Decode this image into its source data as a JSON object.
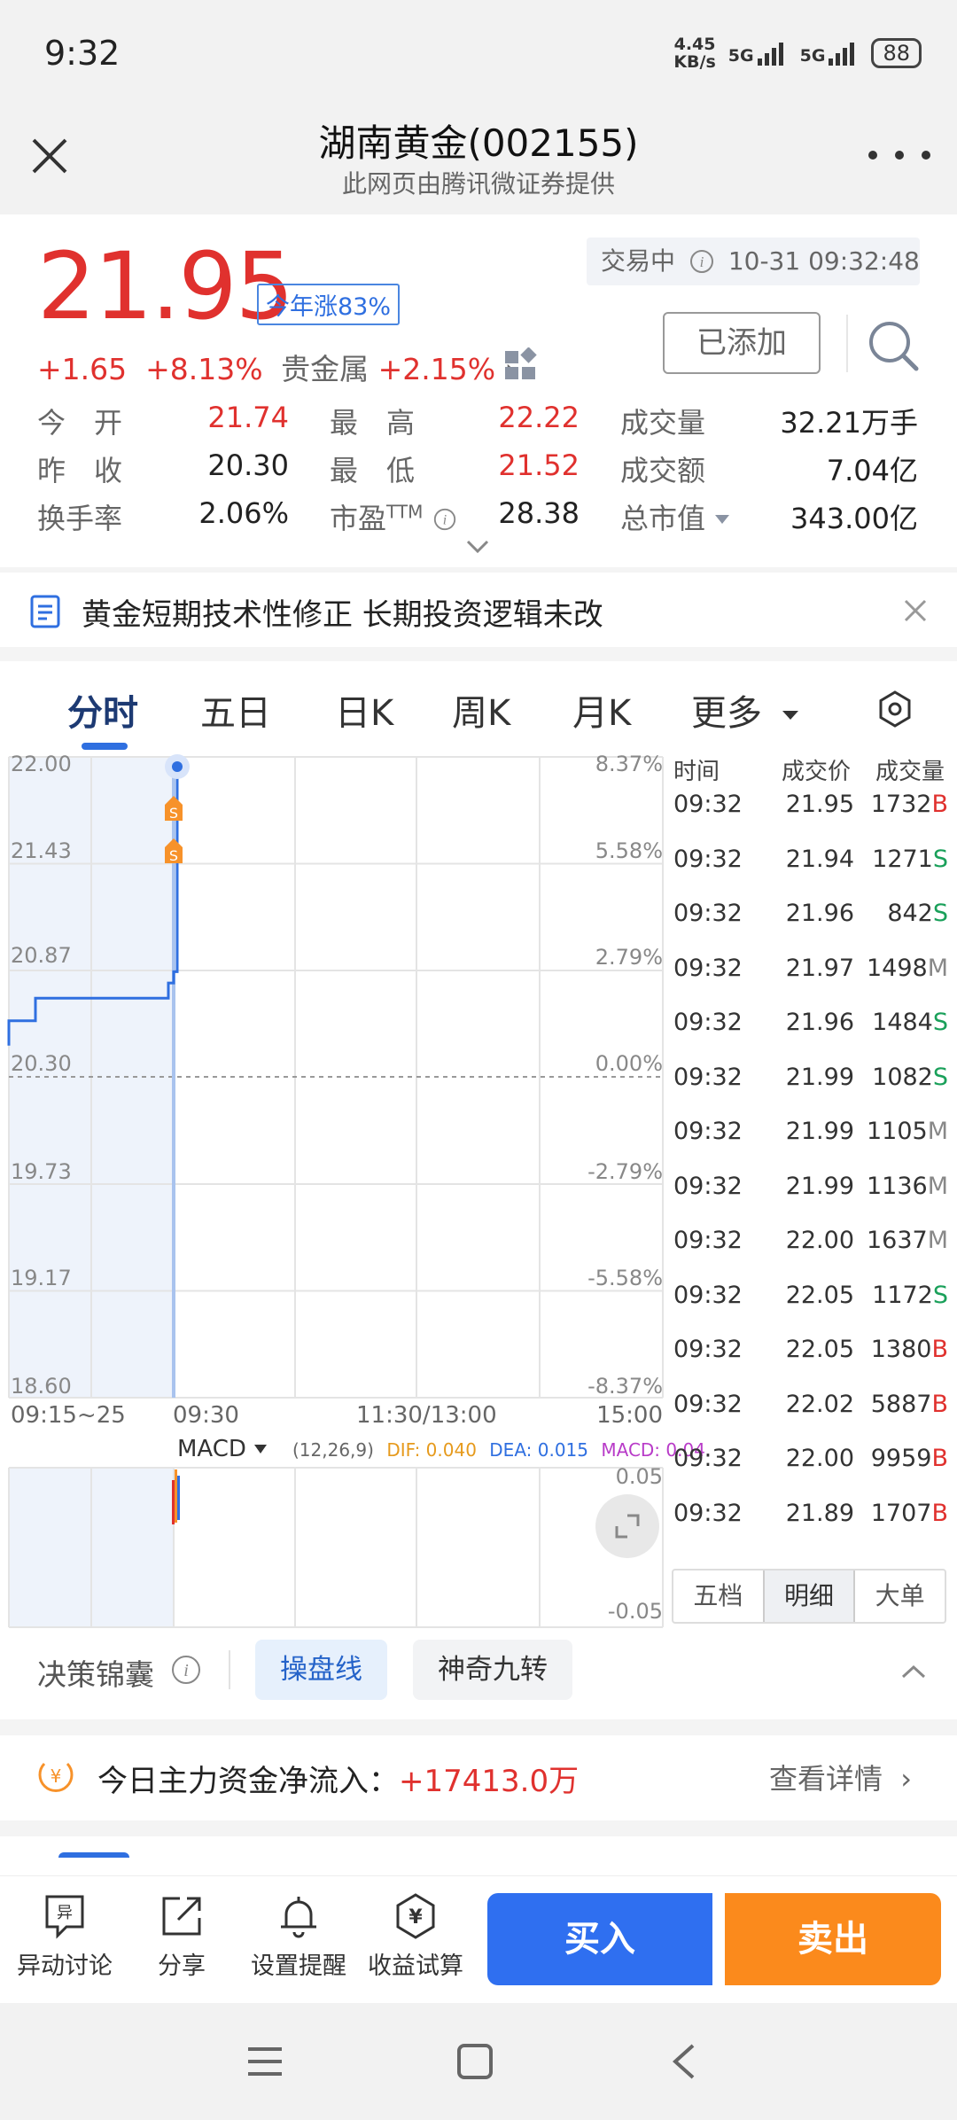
{
  "status_bar": {
    "time": "9:32",
    "net_speed": "4.45\nKB/s",
    "net_speed_top": "4.45",
    "net_speed_bottom": "KB/s",
    "sim1": "5G",
    "sim2": "5G",
    "battery": "88"
  },
  "header": {
    "title": "湖南黄金(002155)",
    "subtitle": "此网页由腾讯微证券提供"
  },
  "quote": {
    "price": "21.95",
    "ytd": "今年涨83%",
    "status": "交易中",
    "datetime": "10-31 09:32:48",
    "added_label": "已添加",
    "change": "+1.65",
    "change_pct": "+8.13%",
    "sector": "贵金属",
    "sector_pct": "+2.15%"
  },
  "stats": {
    "open_label": "今　开",
    "open": "21.74",
    "high_label": "最　高",
    "high": "22.22",
    "volume_label": "成交量",
    "volume": "32.21万手",
    "prev_label": "昨　收",
    "prev": "20.30",
    "low_label": "最　低",
    "low": "21.52",
    "amount_label": "成交额",
    "amount": "7.04亿",
    "turnover_label": "换手率",
    "turnover": "2.06%",
    "pe_label": "市盈",
    "pe_sup": "TTM",
    "pe": "28.38",
    "mcap_label": "总市值",
    "mcap": "343.00亿"
  },
  "notice": {
    "text": "黄金短期技术性修正 长期投资逻辑未改"
  },
  "tabs": [
    "分时",
    "五日",
    "日K",
    "周K",
    "月K",
    "更多"
  ],
  "chart": {
    "y_left": [
      "22.00",
      "21.43",
      "20.87",
      "20.30",
      "19.73",
      "19.17",
      "18.60"
    ],
    "y_right": [
      "8.37%",
      "5.58%",
      "2.79%",
      "0.00%",
      "-2.79%",
      "-5.58%",
      "-8.37%"
    ],
    "x_labels": [
      "09:15~25",
      "09:30",
      "11:30/13:00",
      "15:00"
    ],
    "macd_label": "MACD",
    "macd_params": "(12,26,9)",
    "dif": "DIF: 0.040",
    "dea": "DEA: 0.015",
    "macd_val": "MACD: 0.04",
    "macd_top": "0.05",
    "macd_bottom": "-0.05",
    "marker": "S"
  },
  "chart_data": {
    "type": "line",
    "title": "",
    "xlabel": "",
    "ylabel": "",
    "ylim": [
      18.6,
      22.0
    ],
    "reference_price": 20.3,
    "series": [
      {
        "x": [
          "09:15",
          "09:18",
          "09:25",
          "09:30",
          "09:31",
          "09:32"
        ],
        "values": [
          20.6,
          20.72,
          20.8,
          20.8,
          20.86,
          21.95
        ]
      }
    ]
  },
  "trades": {
    "headers": [
      "时间",
      "成交价",
      "成交量"
    ],
    "rows": [
      {
        "time": "09:32",
        "price": "21.95",
        "vol": "1732",
        "side": "B"
      },
      {
        "time": "09:32",
        "price": "21.94",
        "vol": "1271",
        "side": "S"
      },
      {
        "time": "09:32",
        "price": "21.96",
        "vol": "842",
        "side": "S"
      },
      {
        "time": "09:32",
        "price": "21.97",
        "vol": "1498",
        "side": "M"
      },
      {
        "time": "09:32",
        "price": "21.96",
        "vol": "1484",
        "side": "S"
      },
      {
        "time": "09:32",
        "price": "21.99",
        "vol": "1082",
        "side": "S"
      },
      {
        "time": "09:32",
        "price": "21.99",
        "vol": "1105",
        "side": "M"
      },
      {
        "time": "09:32",
        "price": "21.99",
        "vol": "1136",
        "side": "M"
      },
      {
        "time": "09:32",
        "price": "22.00",
        "vol": "1637",
        "side": "M"
      },
      {
        "time": "09:32",
        "price": "22.05",
        "vol": "1172",
        "side": "S"
      },
      {
        "time": "09:32",
        "price": "22.05",
        "vol": "1380",
        "side": "B"
      },
      {
        "time": "09:32",
        "price": "22.02",
        "vol": "5887",
        "side": "B"
      },
      {
        "time": "09:32",
        "price": "22.00",
        "vol": "9959",
        "side": "B"
      },
      {
        "time": "09:32",
        "price": "21.89",
        "vol": "1707",
        "side": "B"
      }
    ],
    "buttons": [
      "五档",
      "明细",
      "大单"
    ]
  },
  "decision": {
    "label": "决策锦囊",
    "pill1": "操盘线",
    "pill2": "神奇九转"
  },
  "fund_flow": {
    "label": "今日主力资金净流入：",
    "value": "+17413.0万",
    "link": "查看详情"
  },
  "toolbar": {
    "discuss": "异动讨论",
    "discuss_icon_text": "异",
    "share": "分享",
    "alert": "设置提醒",
    "calc": "收益试算",
    "buy": "买入",
    "sell": "卖出"
  },
  "colors": {
    "red": "#e0312e",
    "green": "#1aa05a",
    "blue": "#2f6fe0",
    "orange": "#fb8a1c"
  }
}
